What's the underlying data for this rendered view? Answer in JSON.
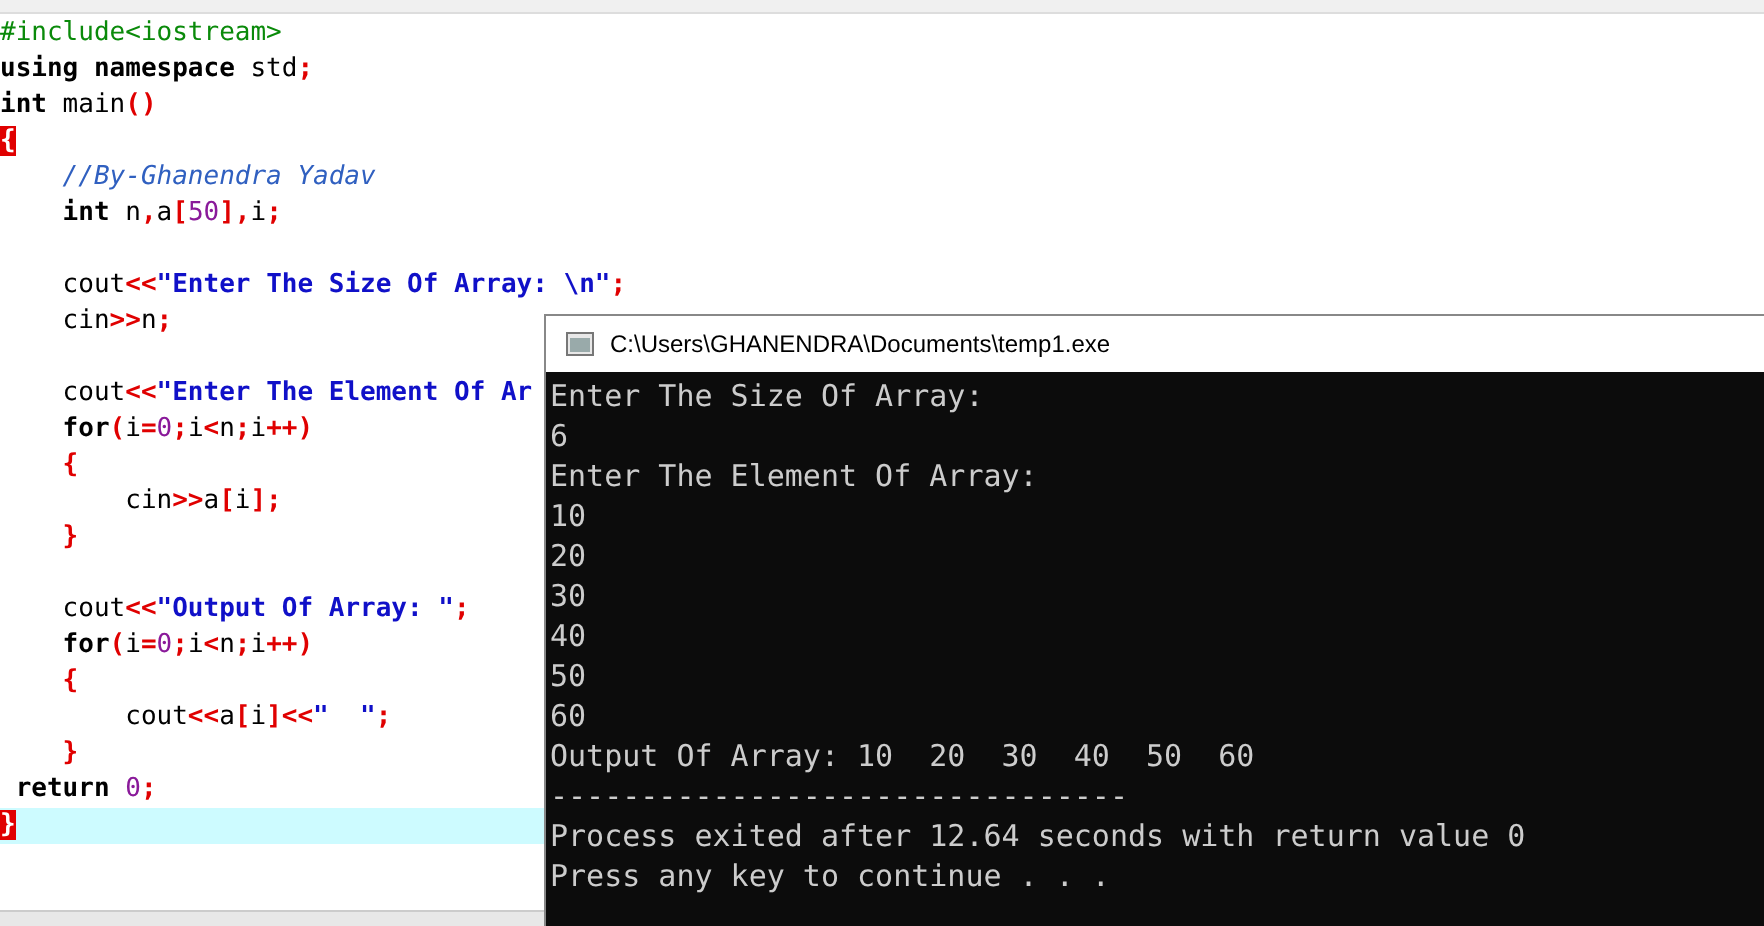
{
  "editor": {
    "lines": [
      {
        "kind": "code",
        "highlighted": false,
        "tokens": [
          {
            "kind": "preprocessor",
            "text": "#include<iostream>"
          }
        ]
      },
      {
        "kind": "code",
        "highlighted": false,
        "tokens": [
          {
            "kind": "keyword",
            "text": "using namespace"
          },
          {
            "kind": "plain",
            "text": " std"
          },
          {
            "kind": "symbol",
            "text": ";"
          }
        ]
      },
      {
        "kind": "code",
        "highlighted": false,
        "tokens": [
          {
            "kind": "keyword",
            "text": "int"
          },
          {
            "kind": "plain",
            "text": " main"
          },
          {
            "kind": "symbol",
            "text": "()"
          }
        ]
      },
      {
        "kind": "code",
        "highlighted": false,
        "tokens": [
          {
            "kind": "brace-match",
            "text": "{"
          }
        ]
      },
      {
        "kind": "code",
        "highlighted": false,
        "tokens": [
          {
            "kind": "comment",
            "text": "    //By-Ghanendra Yadav"
          }
        ]
      },
      {
        "kind": "code",
        "highlighted": false,
        "tokens": [
          {
            "kind": "keyword",
            "text": "    int"
          },
          {
            "kind": "plain",
            "text": " n"
          },
          {
            "kind": "symbol",
            "text": ","
          },
          {
            "kind": "plain",
            "text": "a"
          },
          {
            "kind": "symbol",
            "text": "["
          },
          {
            "kind": "number",
            "text": "50"
          },
          {
            "kind": "symbol",
            "text": "],"
          },
          {
            "kind": "plain",
            "text": "i"
          },
          {
            "kind": "symbol",
            "text": ";"
          }
        ]
      },
      {
        "kind": "blank"
      },
      {
        "kind": "code",
        "highlighted": false,
        "tokens": [
          {
            "kind": "plain",
            "text": "    cout"
          },
          {
            "kind": "symbol",
            "text": "<<"
          },
          {
            "kind": "string",
            "text": "\"Enter The Size Of Array: \\n\""
          },
          {
            "kind": "symbol",
            "text": ";"
          }
        ]
      },
      {
        "kind": "code",
        "highlighted": false,
        "tokens": [
          {
            "kind": "plain",
            "text": "    cin"
          },
          {
            "kind": "symbol",
            "text": ">>"
          },
          {
            "kind": "plain",
            "text": "n"
          },
          {
            "kind": "symbol",
            "text": ";"
          }
        ]
      },
      {
        "kind": "blank"
      },
      {
        "kind": "code",
        "highlighted": false,
        "tokens": [
          {
            "kind": "plain",
            "text": "    cout"
          },
          {
            "kind": "symbol",
            "text": "<<"
          },
          {
            "kind": "string",
            "text": "\"Enter The Element Of Ar"
          }
        ]
      },
      {
        "kind": "code",
        "highlighted": false,
        "tokens": [
          {
            "kind": "keyword",
            "text": "    for"
          },
          {
            "kind": "symbol",
            "text": "("
          },
          {
            "kind": "plain",
            "text": "i"
          },
          {
            "kind": "symbol",
            "text": "="
          },
          {
            "kind": "number",
            "text": "0"
          },
          {
            "kind": "symbol",
            "text": ";"
          },
          {
            "kind": "plain",
            "text": "i"
          },
          {
            "kind": "symbol",
            "text": "<"
          },
          {
            "kind": "plain",
            "text": "n"
          },
          {
            "kind": "symbol",
            "text": ";"
          },
          {
            "kind": "plain",
            "text": "i"
          },
          {
            "kind": "symbol",
            "text": "++)"
          }
        ]
      },
      {
        "kind": "code",
        "highlighted": false,
        "tokens": [
          {
            "kind": "symbol",
            "text": "    {"
          }
        ]
      },
      {
        "kind": "code",
        "highlighted": false,
        "tokens": [
          {
            "kind": "plain",
            "text": "        cin"
          },
          {
            "kind": "symbol",
            "text": ">>"
          },
          {
            "kind": "plain",
            "text": "a"
          },
          {
            "kind": "symbol",
            "text": "["
          },
          {
            "kind": "plain",
            "text": "i"
          },
          {
            "kind": "symbol",
            "text": "];"
          }
        ]
      },
      {
        "kind": "code",
        "highlighted": false,
        "tokens": [
          {
            "kind": "symbol",
            "text": "    }"
          }
        ]
      },
      {
        "kind": "blank"
      },
      {
        "kind": "code",
        "highlighted": false,
        "tokens": [
          {
            "kind": "plain",
            "text": "    cout"
          },
          {
            "kind": "symbol",
            "text": "<<"
          },
          {
            "kind": "string",
            "text": "\"Output Of Array: \""
          },
          {
            "kind": "symbol",
            "text": ";"
          }
        ]
      },
      {
        "kind": "code",
        "highlighted": false,
        "tokens": [
          {
            "kind": "keyword",
            "text": "    for"
          },
          {
            "kind": "symbol",
            "text": "("
          },
          {
            "kind": "plain",
            "text": "i"
          },
          {
            "kind": "symbol",
            "text": "="
          },
          {
            "kind": "number",
            "text": "0"
          },
          {
            "kind": "symbol",
            "text": ";"
          },
          {
            "kind": "plain",
            "text": "i"
          },
          {
            "kind": "symbol",
            "text": "<"
          },
          {
            "kind": "plain",
            "text": "n"
          },
          {
            "kind": "symbol",
            "text": ";"
          },
          {
            "kind": "plain",
            "text": "i"
          },
          {
            "kind": "symbol",
            "text": "++)"
          }
        ]
      },
      {
        "kind": "code",
        "highlighted": false,
        "tokens": [
          {
            "kind": "symbol",
            "text": "    {"
          }
        ]
      },
      {
        "kind": "code",
        "highlighted": false,
        "tokens": [
          {
            "kind": "plain",
            "text": "        cout"
          },
          {
            "kind": "symbol",
            "text": "<<"
          },
          {
            "kind": "plain",
            "text": "a"
          },
          {
            "kind": "symbol",
            "text": "["
          },
          {
            "kind": "plain",
            "text": "i"
          },
          {
            "kind": "symbol",
            "text": "]<<"
          },
          {
            "kind": "string",
            "text": "\"  \""
          },
          {
            "kind": "symbol",
            "text": ";"
          }
        ]
      },
      {
        "kind": "code",
        "highlighted": false,
        "tokens": [
          {
            "kind": "symbol",
            "text": "    }"
          }
        ]
      },
      {
        "kind": "code",
        "highlighted": false,
        "tokens": [
          {
            "kind": "keyword",
            "text": " return"
          },
          {
            "kind": "number",
            "text": " 0"
          },
          {
            "kind": "symbol",
            "text": ";"
          }
        ]
      },
      {
        "kind": "code",
        "highlighted": true,
        "tokens": [
          {
            "kind": "brace-match",
            "text": "}"
          }
        ]
      }
    ]
  },
  "console": {
    "title": "C:\\Users\\GHANENDRA\\Documents\\temp1.exe",
    "lines": [
      "Enter The Size Of Array:",
      "6",
      "Enter The Element Of Array:",
      "10",
      "20",
      "30",
      "40",
      "50",
      "60",
      "Output Of Array: 10  20  30  40  50  60",
      "--------------------------------",
      "Process exited after 12.64 seconds with return value 0",
      "Press any key to continue . . ."
    ]
  }
}
